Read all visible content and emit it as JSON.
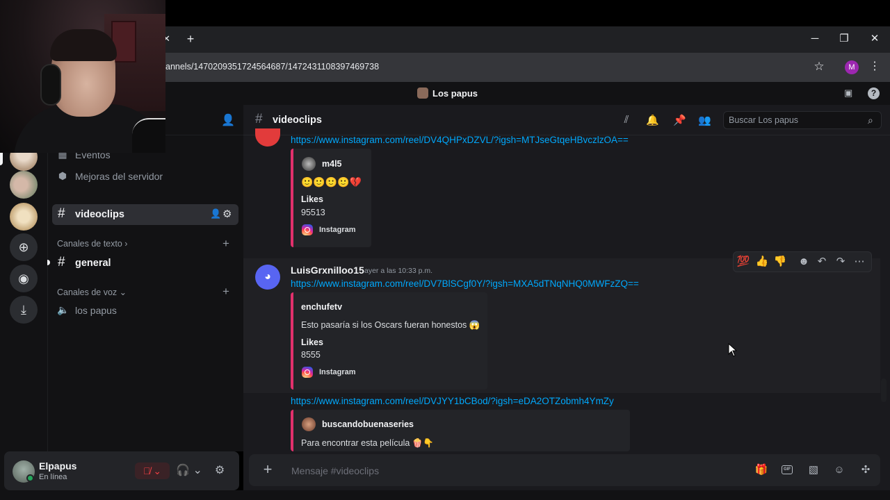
{
  "browser": {
    "url": "annels/1470209351724564687/1472431108397469738",
    "profile_initial": "M",
    "new_tab_icon": "plus-icon",
    "tab_close_icon": "close-icon"
  },
  "discord": {
    "server_name": "Los papus",
    "sidebar": {
      "partial_item": "Eventos",
      "boost_item": "Mejoras del servidor",
      "active_channel": "videoclips",
      "categories": [
        {
          "label": "Canales de texto",
          "channels": [
            "general"
          ]
        },
        {
          "label": "Canales de voz",
          "channels": [
            "los papus"
          ]
        }
      ]
    },
    "user": {
      "name": "Elpapus",
      "status": "En línea"
    },
    "channel_header": {
      "name": "videoclips",
      "search_placeholder": "Buscar Los papus"
    },
    "messages": [
      {
        "link": "https://www.instagram.com/reel/DV4QHPxDZVL/?igsh=MTJseGtqeHBvczlzOA==",
        "embed": {
          "author": "m4l5",
          "description": "🙂🙂🙂🙂💔",
          "field_name": "Likes",
          "field_value": "95513",
          "footer": "Instagram"
        }
      },
      {
        "author": "LuisGrxnilloo15",
        "timestamp": "ayer a las 10:33 p.m.",
        "link": "https://www.instagram.com/reel/DV7BlSCgf0Y/?igsh=MXA5dTNqNHQ0MWFzZQ==",
        "embed": {
          "author": "enchufetv",
          "description": "Esto pasaría si los Oscars fueran honestos 😱",
          "field_name": "Likes",
          "field_value": "8555",
          "footer": "Instagram"
        }
      },
      {
        "link": "https://www.instagram.com/reel/DVJYY1bCBod/?igsh=eDA2OTZobmh4YmZy",
        "embed": {
          "author": "buscandobuenaseries",
          "description": "Para encontrar esta película 🍿👇"
        }
      }
    ],
    "reactions_bar": [
      "💯",
      "👍",
      "👎"
    ],
    "composer_placeholder": "Mensaje #videoclips",
    "colors": {
      "accent": "#5865f2",
      "link": "#00a8fc",
      "embed_border": "#e1306c",
      "online": "#23a55a",
      "muted": "#f23f43"
    }
  }
}
